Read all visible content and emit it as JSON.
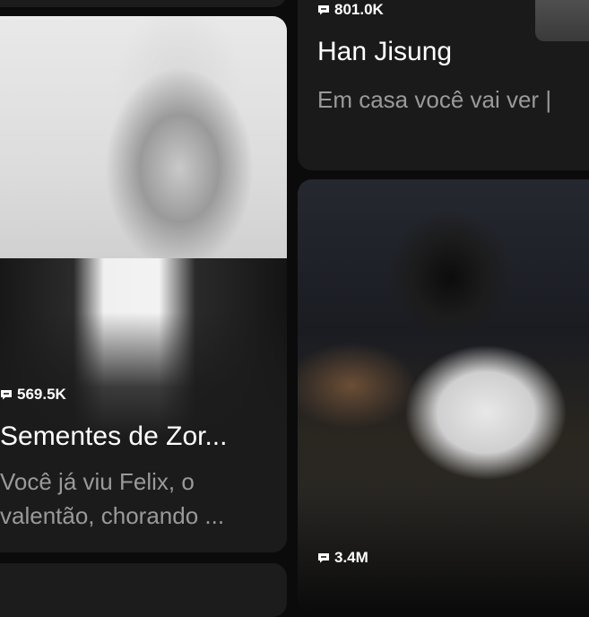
{
  "cards": [
    {
      "id": "left",
      "stat": "569.5K",
      "title": "Sementes de Zor...",
      "description": "Você já viu Felix, o valentão, chorando ..."
    },
    {
      "id": "right-top",
      "stat": "801.0K",
      "title": "Han Jisung",
      "description": "Em casa você vai ver |"
    },
    {
      "id": "right-bottom",
      "stat": "3.4M"
    }
  ],
  "icons": {
    "stat_icon": "chat-bubble-icon"
  },
  "colors": {
    "background": "#0b0b0b",
    "card": "#1b1b1b",
    "description": "#9a9a9a"
  }
}
